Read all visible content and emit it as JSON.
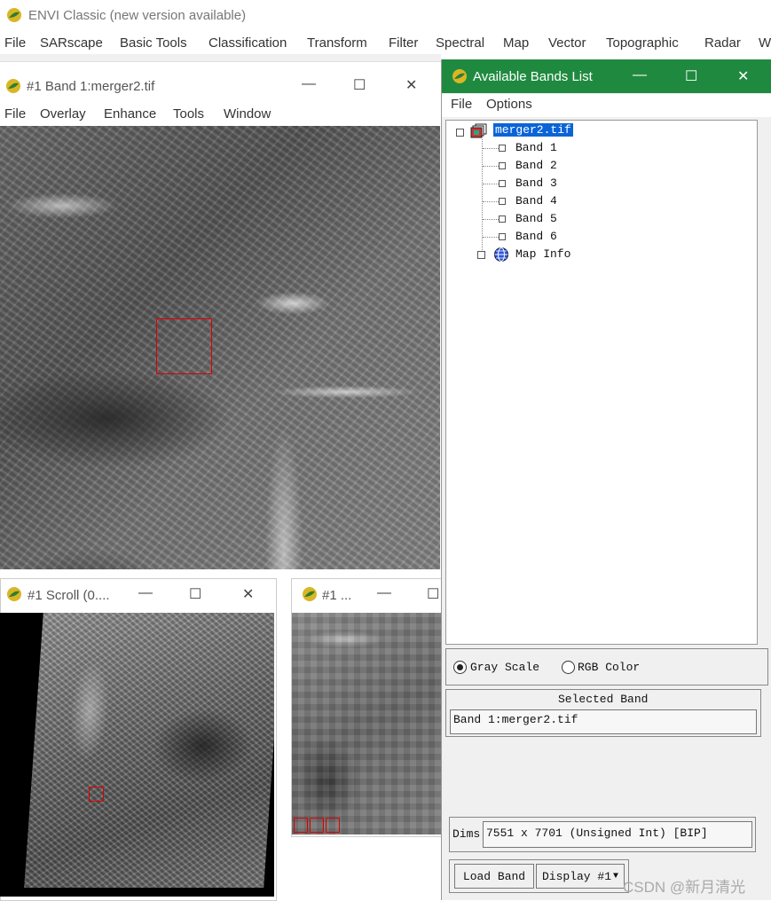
{
  "app": {
    "title": "ENVI Classic (new version available)",
    "menu": [
      "File",
      "SARscape",
      "Basic Tools",
      "Classification",
      "Transform",
      "Filter",
      "Spectral",
      "Map",
      "Vector",
      "Topographic",
      "Radar",
      "W"
    ]
  },
  "image_window": {
    "title": "#1 Band 1:merger2.tif",
    "menu": [
      "File",
      "Overlay",
      "Enhance",
      "Tools",
      "Window"
    ]
  },
  "scroll_window": {
    "title": "#1 Scroll (0...."
  },
  "zoom_window": {
    "title": "#1 ..."
  },
  "bands_list": {
    "title": "Available Bands List",
    "menu": [
      "File",
      "Options"
    ],
    "file_node": "merger2.tif",
    "bands": [
      "Band 1",
      "Band 2",
      "Band 3",
      "Band 4",
      "Band 5",
      "Band 6"
    ],
    "map_info": "Map Info",
    "gray_scale": "Gray Scale",
    "rgb_color": "RGB Color",
    "selected_band_label": "Selected Band",
    "selected_band_value": "Band 1:merger2.tif",
    "dims_label": "Dims",
    "dims_value": "7551 x 7701 (Unsigned Int) [BIP]",
    "load_band": "Load Band",
    "display": "Display #1",
    "watermark": "CSDN @新月清光"
  },
  "window_buttons": {
    "minimize": "—",
    "maximize": "☐",
    "close": "✕"
  },
  "colors": {
    "bands_title_bar": "#1f8a3f",
    "selection": "#0a64d8",
    "roi_box": "#dd0000"
  }
}
